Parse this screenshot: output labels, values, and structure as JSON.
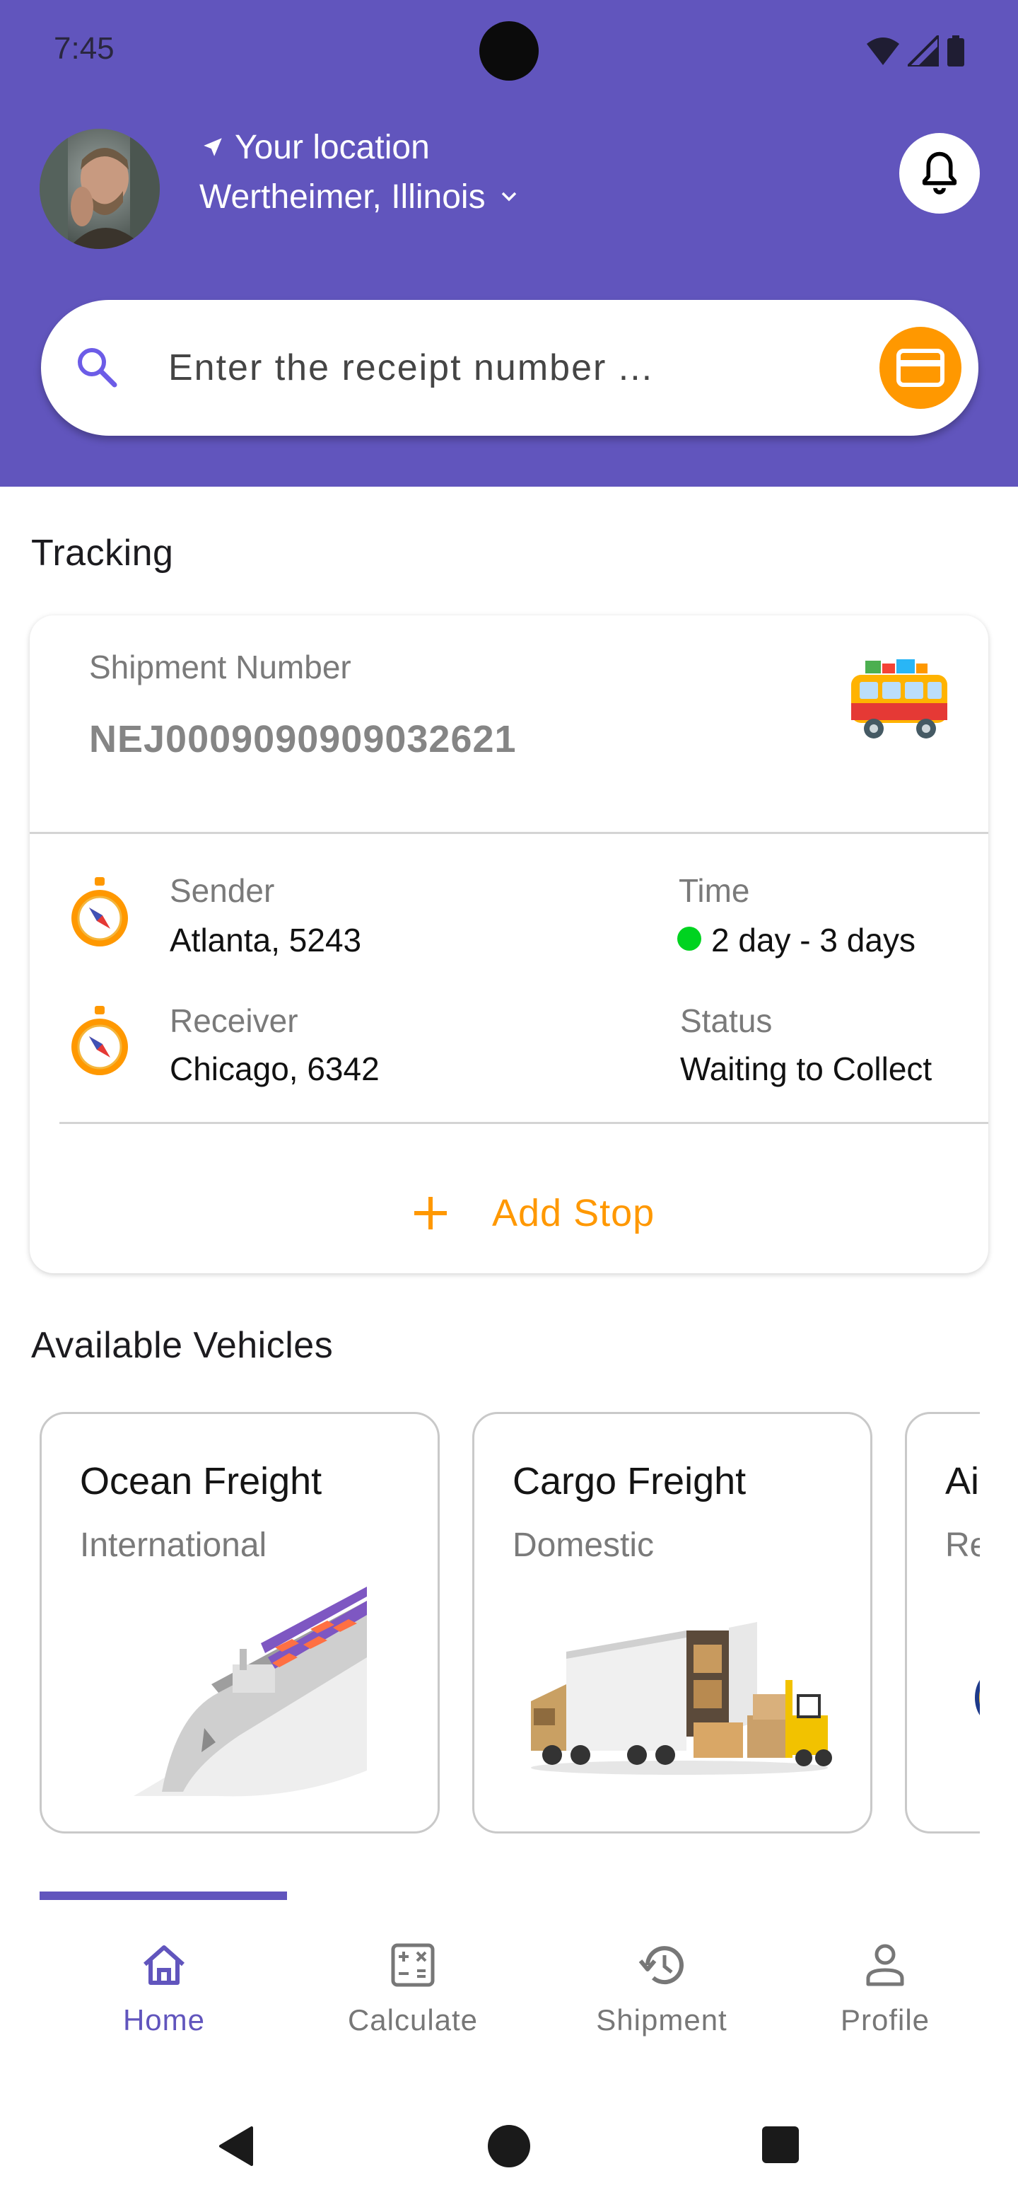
{
  "status_bar": {
    "time": "7:45"
  },
  "header": {
    "location_label": "Your location",
    "location_city": "Wertheimer, Illinois"
  },
  "search": {
    "placeholder": "Enter the receipt number ..."
  },
  "tracking": {
    "title": "Tracking",
    "shipment_label": "Shipment Number",
    "shipment_number": "NEJ0009090909032621",
    "sender_label": "Sender",
    "sender_value": "Atlanta, 5243",
    "time_label": "Time",
    "time_value": "2 day - 3 days",
    "receiver_label": "Receiver",
    "receiver_value": "Chicago, 6342",
    "status_label": "Status",
    "status_value": "Waiting to Collect",
    "add_stop": "Add Stop"
  },
  "vehicles": {
    "title": "Available Vehicles",
    "items": [
      {
        "title": "Ocean Freight",
        "subtitle": "International"
      },
      {
        "title": "Cargo Freight",
        "subtitle": "Domestic"
      },
      {
        "title": "Air Freight",
        "subtitle": "Re"
      }
    ]
  },
  "nav": {
    "items": [
      {
        "label": "Home",
        "icon": "home-icon",
        "active": true
      },
      {
        "label": "Calculate",
        "icon": "calculator-icon",
        "active": false
      },
      {
        "label": "Shipment",
        "icon": "history-icon",
        "active": false
      },
      {
        "label": "Profile",
        "icon": "person-icon",
        "active": false
      }
    ]
  },
  "colors": {
    "primary": "#6155bd",
    "accent": "#ff9800",
    "status_dot": "#00d320"
  }
}
